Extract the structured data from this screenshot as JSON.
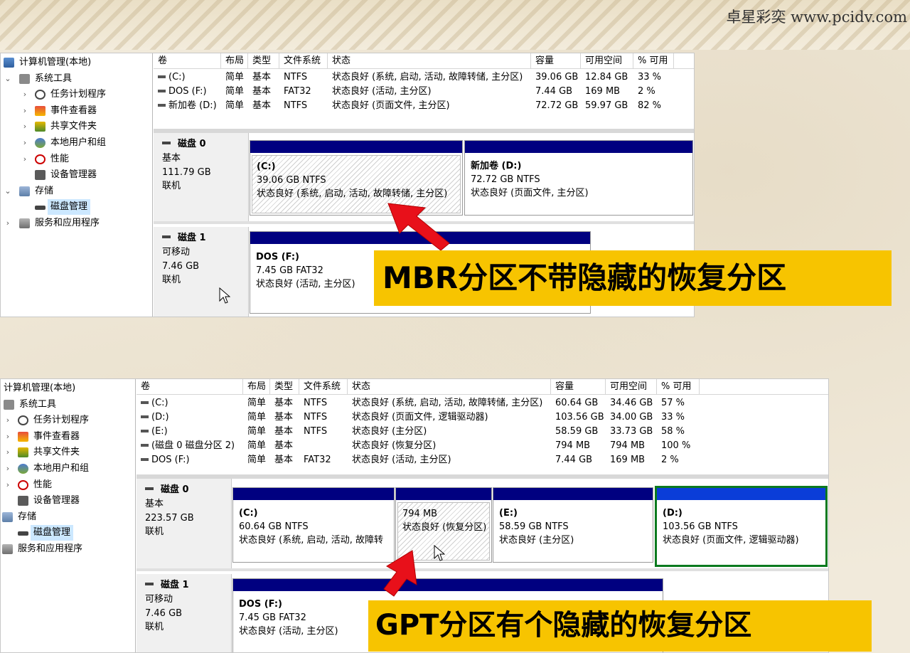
{
  "site_credit": "卓星彩奕 www.pcidv.com",
  "tree_items": {
    "root": "计算机管理(本地)",
    "system_tools": "系统工具",
    "task_scheduler": "任务计划程序",
    "event_viewer": "事件查看器",
    "shared_folders": "共享文件夹",
    "local_users": "本地用户和组",
    "performance": "性能",
    "device_manager": "设备管理器",
    "storage": "存储",
    "disk_management": "磁盘管理",
    "services": "服务和应用程序"
  },
  "columns": [
    "卷",
    "布局",
    "类型",
    "文件系统",
    "状态",
    "容量",
    "可用空间",
    "% 可用"
  ],
  "mbr": {
    "volumes": [
      {
        "name": "(C:)",
        "layout": "简单",
        "type": "基本",
        "fs": "NTFS",
        "status": "状态良好 (系统, 启动, 活动, 故障转储, 主分区)",
        "capacity": "39.06 GB",
        "free": "12.84 GB",
        "pct": "33 %"
      },
      {
        "name": "DOS (F:)",
        "layout": "简单",
        "type": "基本",
        "fs": "FAT32",
        "status": "状态良好 (活动, 主分区)",
        "capacity": "7.44 GB",
        "free": "169 MB",
        "pct": "2 %"
      },
      {
        "name": "新加卷 (D:)",
        "layout": "简单",
        "type": "基本",
        "fs": "NTFS",
        "status": "状态良好 (页面文件, 主分区)",
        "capacity": "72.72 GB",
        "free": "59.97 GB",
        "pct": "82 %"
      }
    ],
    "disks": [
      {
        "name": "磁盘 0",
        "type": "基本",
        "size": "111.79 GB",
        "state": "联机",
        "partitions": [
          {
            "label": "(C:)",
            "size": "39.06 GB NTFS",
            "status": "状态良好 (系统, 启动, 活动, 故障转储, 主分区)"
          },
          {
            "label": "新加卷  (D:)",
            "size": "72.72 GB NTFS",
            "status": "状态良好 (页面文件, 主分区)"
          }
        ]
      },
      {
        "name": "磁盘 1",
        "type": "可移动",
        "size": "7.46 GB",
        "state": "联机",
        "partitions": [
          {
            "label": "DOS  (F:)",
            "size": "7.45 GB FAT32",
            "status": "状态良好 (活动, 主分区)"
          }
        ]
      }
    ],
    "callout": "MBR分区不带隐藏的恢复分区"
  },
  "gpt": {
    "volumes": [
      {
        "name": "(C:)",
        "layout": "简单",
        "type": "基本",
        "fs": "NTFS",
        "status": "状态良好 (系统, 启动, 活动, 故障转储, 主分区)",
        "capacity": "60.64 GB",
        "free": "34.46 GB",
        "pct": "57 %"
      },
      {
        "name": "(D:)",
        "layout": "简单",
        "type": "基本",
        "fs": "NTFS",
        "status": "状态良好 (页面文件, 逻辑驱动器)",
        "capacity": "103.56 GB",
        "free": "34.00 GB",
        "pct": "33 %"
      },
      {
        "name": "(E:)",
        "layout": "简单",
        "type": "基本",
        "fs": "NTFS",
        "status": "状态良好 (主分区)",
        "capacity": "58.59 GB",
        "free": "33.73 GB",
        "pct": "58 %"
      },
      {
        "name": "(磁盘 0 磁盘分区 2)",
        "layout": "简单",
        "type": "基本",
        "fs": "",
        "status": "状态良好 (恢复分区)",
        "capacity": "794 MB",
        "free": "794 MB",
        "pct": "100 %"
      },
      {
        "name": "DOS (F:)",
        "layout": "简单",
        "type": "基本",
        "fs": "FAT32",
        "status": "状态良好 (活动, 主分区)",
        "capacity": "7.44 GB",
        "free": "169 MB",
        "pct": "2 %"
      }
    ],
    "disks": [
      {
        "name": "磁盘 0",
        "type": "基本",
        "size": "223.57 GB",
        "state": "联机",
        "partitions": [
          {
            "label": "(C:)",
            "size": "60.64 GB NTFS",
            "status": "状态良好 (系统, 启动, 活动, 故障转",
            "hatched": false
          },
          {
            "label": "",
            "size": "794 MB",
            "status": "状态良好 (恢复分区)",
            "hatched": true
          },
          {
            "label": "(E:)",
            "size": "58.59 GB NTFS",
            "status": "状态良好 (主分区)",
            "hatched": false
          },
          {
            "label": "(D:)",
            "size": "103.56 GB NTFS",
            "status": "状态良好 (页面文件, 逻辑驱动器)",
            "hatched": false
          }
        ]
      },
      {
        "name": "磁盘 1",
        "type": "可移动",
        "size": "7.46 GB",
        "state": "联机",
        "partitions": [
          {
            "label": "DOS  (F:)",
            "size": "7.45 GB FAT32",
            "status": "状态良好 (活动, 主分区)"
          }
        ]
      }
    ],
    "callout": "GPT分区有个隐藏的恢复分区"
  },
  "colors": {
    "partition_bar": "#000080",
    "selected_partition_bar": "#0a3dd8",
    "selected_border": "#0b7a1f",
    "callout_bg": "#f7c400",
    "arrow": "#e8101a"
  },
  "icons": {
    "arrow": "red-arrow-icon",
    "cursor": "mouse-pointer-icon"
  }
}
